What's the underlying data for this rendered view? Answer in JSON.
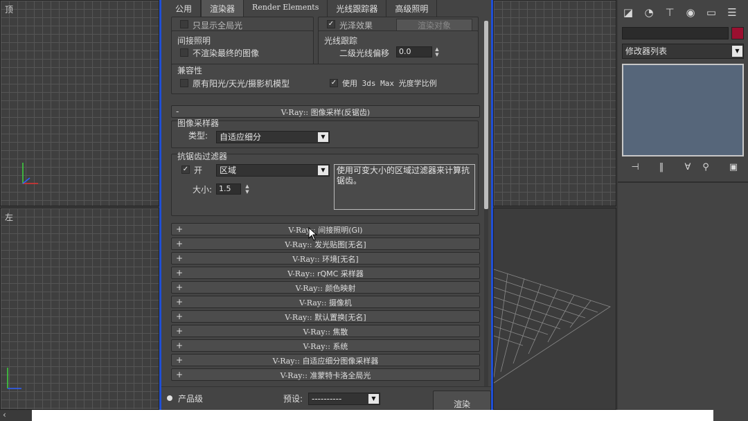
{
  "viewports": {
    "top_label": "顶",
    "left_label": "左"
  },
  "dialog": {
    "tabs": [
      {
        "label": "公用"
      },
      {
        "label": "渲染器"
      },
      {
        "label": "Render Elements"
      },
      {
        "label": "光线跟踪器"
      },
      {
        "label": "高级照明"
      }
    ],
    "active_tab": "渲染器",
    "top_partial": {
      "left_option": "只显示全局光",
      "right_option": "光泽效果",
      "right_button": "渲染对象"
    },
    "indirect": {
      "title": "间接照明",
      "option": "不渲染最终的图像"
    },
    "raytrace": {
      "title": "光线跟踪",
      "bias_label": "二级光线偏移",
      "bias_value": "0.0"
    },
    "compat": {
      "title": "兼容性",
      "legacy": "原有阳光/天光/摄影机模型",
      "photometric": "使用 3ds Max 光度学比例",
      "legacy_checked": false,
      "photometric_checked": true
    },
    "image_sampler_rollout": {
      "sign": "-",
      "prefix": "V-Ray::",
      "title": "图像采样(反锯齿)"
    },
    "image_sampler": {
      "group_title": "图像采样器",
      "type_label": "类型:",
      "type_value": "自适应细分"
    },
    "aa_filter": {
      "group_title": "抗锯齿过滤器",
      "on_label": "开",
      "on_checked": true,
      "filter_value": "区域",
      "size_label": "大小:",
      "size_value": "1.5",
      "description": "使用可变大小的区域过滤器来计算抗锯齿。"
    },
    "rollouts": [
      {
        "sign": "+",
        "prefix": "V-Ray::",
        "title": "间接照明(GI)"
      },
      {
        "sign": "+",
        "prefix": "V-Ray::",
        "title": "发光贴图[无名]"
      },
      {
        "sign": "+",
        "prefix": "V-Ray::",
        "title": "环境[无名]"
      },
      {
        "sign": "+",
        "prefix": "V-Ray::",
        "title": "rQMC 采样器"
      },
      {
        "sign": "+",
        "prefix": "V-Ray::",
        "title": "颜色映射"
      },
      {
        "sign": "+",
        "prefix": "V-Ray::",
        "title": "摄像机"
      },
      {
        "sign": "+",
        "prefix": "V-Ray::",
        "title": "默认置换[无名]"
      },
      {
        "sign": "+",
        "prefix": "V-Ray::",
        "title": "焦散"
      },
      {
        "sign": "+",
        "prefix": "V-Ray::",
        "title": "系统"
      },
      {
        "sign": "+",
        "prefix": "V-Ray::",
        "title": "自适应细分图像采样器"
      },
      {
        "sign": "+",
        "prefix": "V-Ray::",
        "title": "准蒙特卡洛全局光"
      }
    ],
    "footer": {
      "mode_label": "产品级",
      "preset_label": "预设:",
      "preset_value": "----------",
      "render_button": "渲染"
    }
  },
  "command_panel": {
    "icons": [
      "create-icon",
      "modify-icon",
      "hierarchy-icon",
      "motion-icon",
      "display-icon",
      "utilities-icon"
    ],
    "modifier_list": "修改器列表",
    "colors": {
      "swatch": "#9b1030",
      "stack_bg": "#56667a"
    }
  },
  "accent": "#1f4fd6"
}
